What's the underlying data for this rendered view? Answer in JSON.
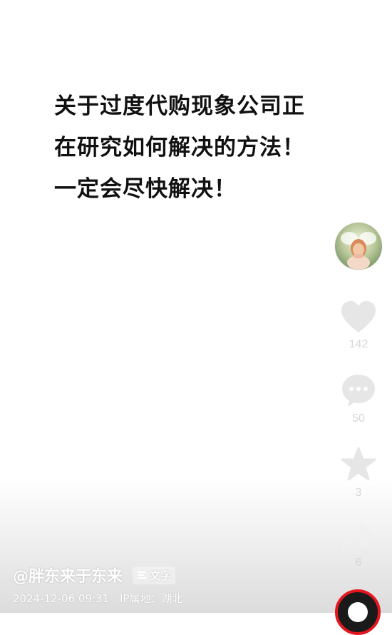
{
  "post": {
    "lines": [
      "关于过度代购现象公司正",
      "在研究如何解决的方法！",
      "一定会尽快解决！"
    ]
  },
  "actions": {
    "like_count": "142",
    "comment_count": "50",
    "favorite_count": "3",
    "share_count": "6"
  },
  "author": {
    "name": "@胖东来于东来",
    "text_tag_label": "文字"
  },
  "meta": {
    "date": "2024-12-06 09:31",
    "ip_location": "IP属地：湖北"
  },
  "icons": {
    "like": "heart-icon",
    "comment": "comment-dots-icon",
    "favorite": "star-icon",
    "share": "share-arrow-icon",
    "text_tag": "text-lines-icon",
    "music": "music-disc-icon"
  },
  "colors": {
    "icon_fill": "#e6e6e6",
    "text_primary": "#111111",
    "disc_ring": "#e4161f"
  }
}
